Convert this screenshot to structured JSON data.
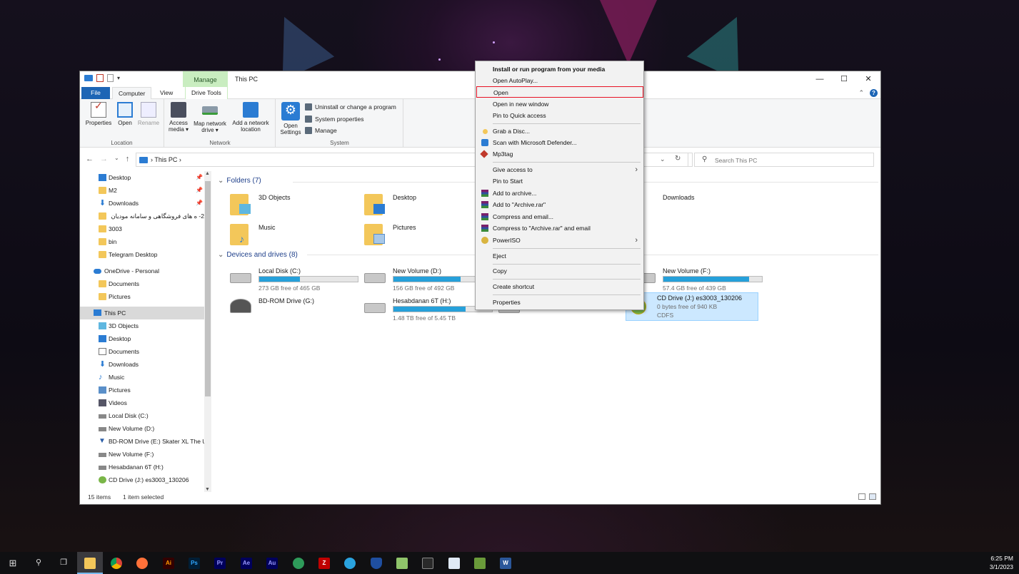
{
  "window": {
    "title": "This PC",
    "manage_tab": "Manage",
    "controls": {
      "minimize": "—",
      "maximize": "☐",
      "close": "✕"
    }
  },
  "tabs": {
    "file": "File",
    "computer": "Computer",
    "view": "View",
    "drive_tools": "Drive Tools"
  },
  "ribbon": {
    "location": {
      "label": "Location",
      "properties": "Properties",
      "open": "Open",
      "rename": "Rename"
    },
    "network": {
      "label": "Network",
      "access_media": "Access media ▾",
      "access_media_1": "Access",
      "access_media_2": "media ▾",
      "map_drive_1": "Map network",
      "map_drive_2": "drive ▾",
      "add_location_1": "Add a network",
      "add_location_2": "location"
    },
    "system": {
      "label": "System",
      "open_settings_1": "Open",
      "open_settings_2": "Settings",
      "uninstall": "Uninstall or change a program",
      "system_properties": "System properties",
      "manage": "Manage"
    }
  },
  "address": {
    "crumb": "This PC",
    "sep": "›",
    "search_placeholder": "Search This PC"
  },
  "nav": {
    "quick": [
      {
        "label": "Desktop",
        "icon": "desktop-icon",
        "pinned": true
      },
      {
        "label": "M2",
        "icon": "folder-icon",
        "pinned": true
      },
      {
        "label": "Downloads",
        "icon": "download-icon",
        "pinned": true
      },
      {
        "label": "2- ه های فروشگاهی و سامانه مودیان",
        "icon": "folder-icon",
        "pinned": false
      },
      {
        "label": "3003",
        "icon": "folder-icon",
        "pinned": false
      },
      {
        "label": "bin",
        "icon": "folder-icon",
        "pinned": false
      },
      {
        "label": "Telegram Desktop",
        "icon": "folder-icon",
        "pinned": false
      }
    ],
    "onedrive": {
      "label": "OneDrive - Personal",
      "children": [
        "Documents",
        "Pictures"
      ]
    },
    "thispc": {
      "label": "This PC"
    },
    "thispc_children": [
      {
        "label": "3D Objects",
        "icon": "cube-icon"
      },
      {
        "label": "Desktop",
        "icon": "desktop-icon"
      },
      {
        "label": "Documents",
        "icon": "document-icon"
      },
      {
        "label": "Downloads",
        "icon": "download-icon"
      },
      {
        "label": "Music",
        "icon": "music-icon"
      },
      {
        "label": "Pictures",
        "icon": "pictures-icon"
      },
      {
        "label": "Videos",
        "icon": "videos-icon"
      },
      {
        "label": "Local Disk (C:)",
        "icon": "drive-icon"
      },
      {
        "label": "New Volume (D:)",
        "icon": "drive-icon"
      },
      {
        "label": "BD-ROM Drive (E:) Skater XL The U",
        "icon": "bdrom-icon"
      },
      {
        "label": "New Volume (F:)",
        "icon": "drive-icon"
      },
      {
        "label": "Hesabdanan 6T (H:)",
        "icon": "drive-icon"
      },
      {
        "label": "CD Drive (J:) es3003_130206",
        "icon": "cd-drive-icon"
      }
    ]
  },
  "content": {
    "folders_header": "Folders (7)",
    "folders": [
      {
        "name": "3D Objects"
      },
      {
        "name": "Desktop"
      },
      {
        "name": "Downloads"
      },
      {
        "name": "Music"
      },
      {
        "name": "Pictures"
      }
    ],
    "drives_header": "Devices and drives (8)",
    "drives": [
      {
        "name": "Local Disk (C:)",
        "free": "273 GB free of 465 GB",
        "used_fraction": 0.41
      },
      {
        "name": "New Volume (D:)",
        "free": "156 GB free of 492 GB",
        "used_fraction": 0.68
      },
      {
        "name": "New Volume (F:)",
        "free": "57.4 GB free of 439 GB",
        "used_fraction": 0.87
      },
      {
        "name": "BD-ROM Drive (G:)",
        "free": "",
        "used_fraction": null
      },
      {
        "name": "Hesabdanan 6T (H:)",
        "free": "1.48 TB free of 5.45 TB",
        "used_fraction": 0.73
      },
      {
        "name": "CD Drive (J:) es3003_130206",
        "free": "0 bytes free of 940 KB",
        "fs": "CDFS",
        "used_fraction": null
      }
    ]
  },
  "status": {
    "items": "15 items",
    "selected": "1 item selected"
  },
  "context_menu": {
    "items": [
      {
        "label": "Install or run program from your media",
        "bold": true
      },
      {
        "label": "Open AutoPlay..."
      },
      {
        "label": "Open",
        "highlighted": true
      },
      {
        "label": "Open in new window"
      },
      {
        "label": "Pin to Quick access"
      },
      {
        "label": "Grab a Disc...",
        "icon": "hand-icon"
      },
      {
        "label": "Scan with Microsoft Defender...",
        "icon": "defender-icon"
      },
      {
        "label": "Mp3tag",
        "icon": "mp3tag-icon"
      },
      {
        "label": "Give access to",
        "submenu": true
      },
      {
        "label": "Pin to Start"
      },
      {
        "label": "Add to archive...",
        "icon": "winrar-icon"
      },
      {
        "label": "Add to \"Archive.rar\"",
        "icon": "winrar-icon"
      },
      {
        "label": "Compress and email...",
        "icon": "winrar-icon"
      },
      {
        "label": "Compress to \"Archive.rar\" and email",
        "icon": "winrar-icon"
      },
      {
        "label": "PowerISO",
        "icon": "poweriso-icon",
        "submenu": true
      },
      {
        "label": "Eject"
      },
      {
        "label": "Copy"
      },
      {
        "label": "Create shortcut"
      },
      {
        "label": "Properties"
      }
    ]
  },
  "taskbar": {
    "icons": [
      "windows-start-icon",
      "search-icon",
      "task-view-icon",
      "file-explorer-icon",
      "chrome-icon",
      "firefox-icon",
      "illustrator-icon",
      "photoshop-icon",
      "premiere-icon",
      "after-effects-icon",
      "audition-icon",
      "edge-icon",
      "filezilla-icon",
      "telegram-icon",
      "vpn-shield-icon",
      "notepad-icon",
      "terminal-icon",
      "app-window-icon",
      "game-icon",
      "word-icon"
    ],
    "app_labels": {
      "ai": "Ai",
      "ps": "Ps",
      "pr": "Pr",
      "ae": "Ae",
      "au": "Au",
      "w": "W"
    },
    "time": "6:25 PM",
    "date": "3/1/2023"
  }
}
